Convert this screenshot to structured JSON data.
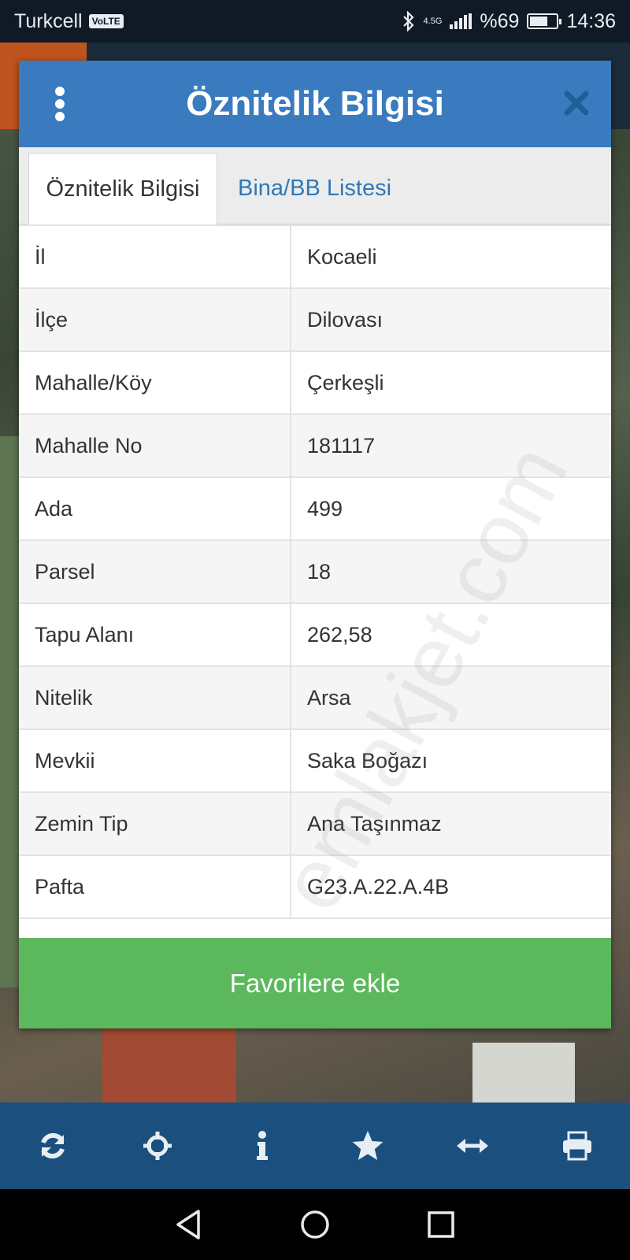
{
  "status_bar": {
    "carrier": "Turkcell",
    "volte": "VoLTE",
    "network": "4.5G",
    "battery_text": "%69",
    "battery_level": 0.69,
    "time": "14:36"
  },
  "dialog": {
    "title": "Öznitelik Bilgisi",
    "tabs": [
      {
        "label": "Öznitelik Bilgisi",
        "active": true
      },
      {
        "label": "Bina/BB Listesi",
        "active": false
      }
    ],
    "rows": [
      {
        "key": "İl",
        "value": "Kocaeli"
      },
      {
        "key": "İlçe",
        "value": "Dilovası"
      },
      {
        "key": "Mahalle/Köy",
        "value": "Çerkeşli"
      },
      {
        "key": "Mahalle No",
        "value": "181117"
      },
      {
        "key": "Ada",
        "value": "499"
      },
      {
        "key": "Parsel",
        "value": "18"
      },
      {
        "key": "Tapu Alanı",
        "value": "262,58"
      },
      {
        "key": "Nitelik",
        "value": "Arsa"
      },
      {
        "key": "Mevkii",
        "value": "Saka Boğazı"
      },
      {
        "key": "Zemin Tip",
        "value": "Ana Taşınmaz"
      },
      {
        "key": "Pafta",
        "value": "G23.A.22.A.4B"
      }
    ],
    "favorite_label": "Favorilere ekle",
    "watermark": "emlakjet.com"
  },
  "toolbar": {
    "icons": [
      "refresh-icon",
      "crosshair-icon",
      "info-icon",
      "star-icon",
      "measure-icon",
      "print-icon"
    ]
  },
  "navbar": {
    "icons": [
      "back-icon",
      "home-icon",
      "recents-icon"
    ]
  },
  "colors": {
    "header_blue": "#3a7bbf",
    "toolbar_blue": "#1b4f7d",
    "button_green": "#5cb85c",
    "tab_link": "#2f79b7"
  }
}
